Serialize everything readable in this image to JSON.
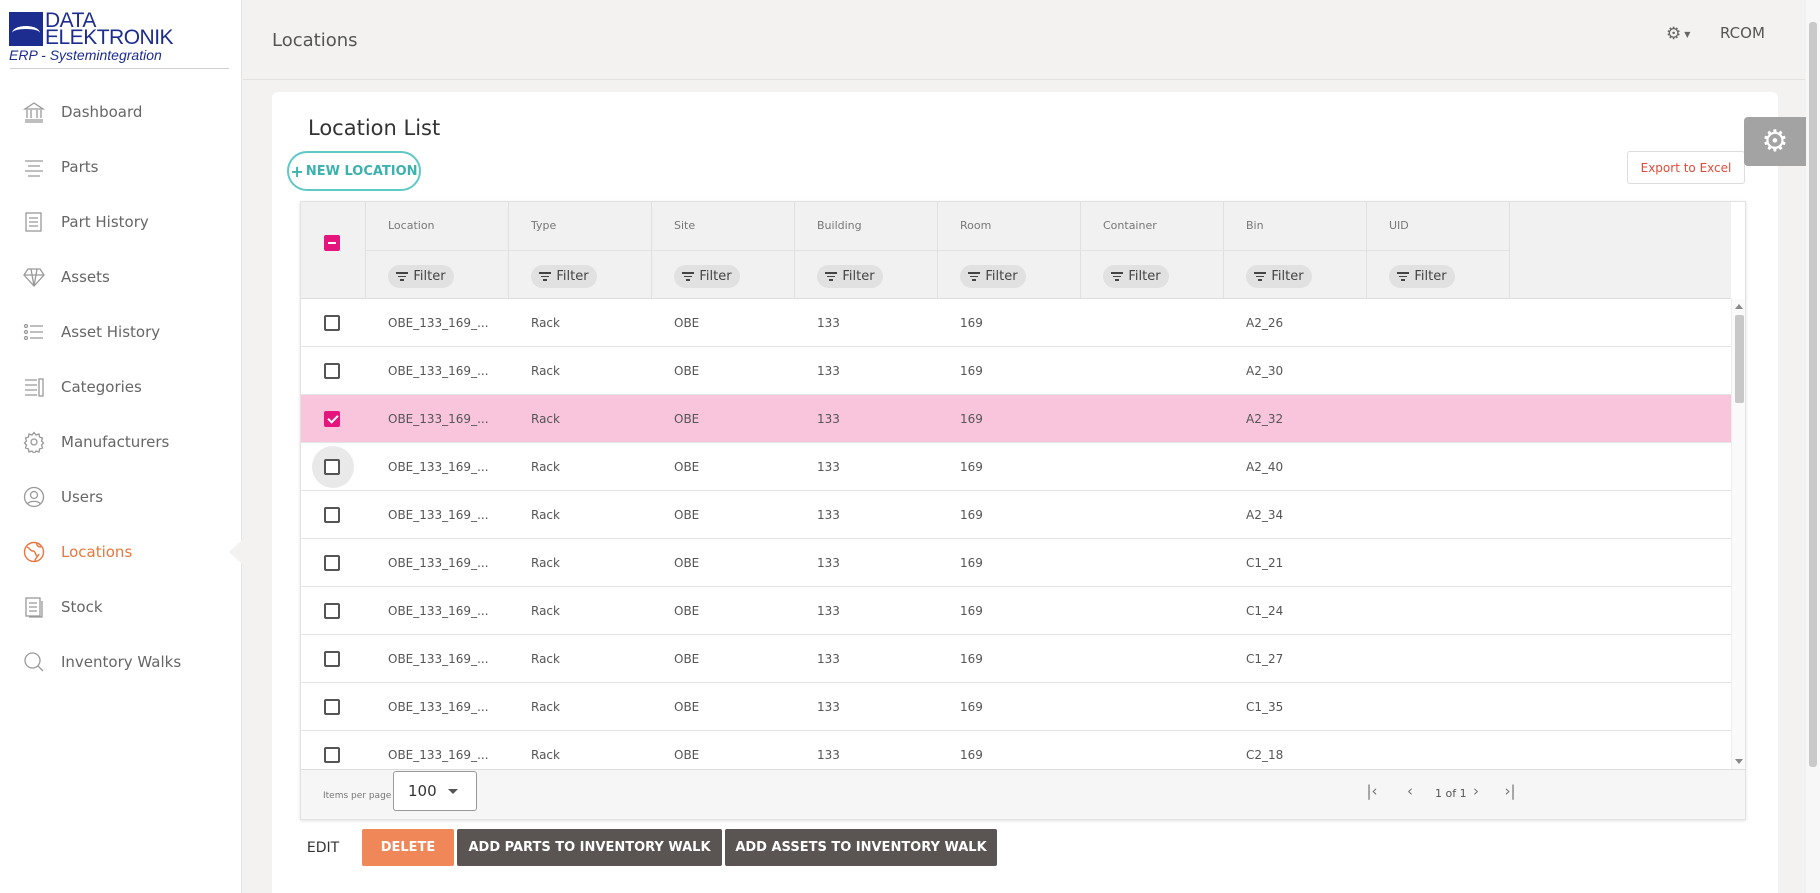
{
  "logo": {
    "line1": "DATA",
    "line2": "ELEKTRONIK",
    "sub": "ERP - Systemintegration"
  },
  "sidebar": {
    "items": [
      {
        "label": "Dashboard",
        "icon": "bank-icon"
      },
      {
        "label": "Parts",
        "icon": "lines-icon"
      },
      {
        "label": "Part History",
        "icon": "document-list-icon"
      },
      {
        "label": "Assets",
        "icon": "diamond-icon"
      },
      {
        "label": "Asset History",
        "icon": "list-icon"
      },
      {
        "label": "Categories",
        "icon": "categories-icon"
      },
      {
        "label": "Manufacturers",
        "icon": "gear-icon"
      },
      {
        "label": "Users",
        "icon": "user-icon"
      },
      {
        "label": "Locations",
        "icon": "globe-icon",
        "active": true
      },
      {
        "label": "Stock",
        "icon": "stock-icon"
      },
      {
        "label": "Inventory Walks",
        "icon": "search-icon"
      }
    ],
    "active_color": "#e8763e"
  },
  "header": {
    "title": "Locations",
    "user": "RCOM"
  },
  "card": {
    "title": "Location List",
    "new_button": "NEW LOCATION",
    "export_button": "Export to Excel"
  },
  "table": {
    "columns": [
      "Location",
      "Type",
      "Site",
      "Building",
      "Room",
      "Container",
      "Bin",
      "UID"
    ],
    "filter_label": "Filter",
    "rows": [
      {
        "location": "OBE_133_169_...",
        "type": "Rack",
        "site": "OBE",
        "building": "133",
        "room": "169",
        "container": "",
        "bin": "A2_26",
        "uid": "",
        "checked": false
      },
      {
        "location": "OBE_133_169_...",
        "type": "Rack",
        "site": "OBE",
        "building": "133",
        "room": "169",
        "container": "",
        "bin": "A2_30",
        "uid": "",
        "checked": false
      },
      {
        "location": "OBE_133_169_...",
        "type": "Rack",
        "site": "OBE",
        "building": "133",
        "room": "169",
        "container": "",
        "bin": "A2_32",
        "uid": "",
        "checked": true
      },
      {
        "location": "OBE_133_169_...",
        "type": "Rack",
        "site": "OBE",
        "building": "133",
        "room": "169",
        "container": "",
        "bin": "A2_40",
        "uid": "",
        "checked": false,
        "focused": true
      },
      {
        "location": "OBE_133_169_...",
        "type": "Rack",
        "site": "OBE",
        "building": "133",
        "room": "169",
        "container": "",
        "bin": "A2_34",
        "uid": "",
        "checked": false
      },
      {
        "location": "OBE_133_169_...",
        "type": "Rack",
        "site": "OBE",
        "building": "133",
        "room": "169",
        "container": "",
        "bin": "C1_21",
        "uid": "",
        "checked": false
      },
      {
        "location": "OBE_133_169_...",
        "type": "Rack",
        "site": "OBE",
        "building": "133",
        "room": "169",
        "container": "",
        "bin": "C1_24",
        "uid": "",
        "checked": false
      },
      {
        "location": "OBE_133_169_...",
        "type": "Rack",
        "site": "OBE",
        "building": "133",
        "room": "169",
        "container": "",
        "bin": "C1_27",
        "uid": "",
        "checked": false
      },
      {
        "location": "OBE_133_169_...",
        "type": "Rack",
        "site": "OBE",
        "building": "133",
        "room": "169",
        "container": "",
        "bin": "C1_35",
        "uid": "",
        "checked": false
      },
      {
        "location": "OBE_133_169_...",
        "type": "Rack",
        "site": "OBE",
        "building": "133",
        "room": "169",
        "container": "",
        "bin": "C2_18",
        "uid": "",
        "checked": false
      }
    ],
    "selected_row_color": "#f9c5dd",
    "items_per_page_label": "Items per page",
    "items_per_page": "100",
    "page_info": "1 of 1"
  },
  "actions": {
    "edit": "EDIT",
    "delete": "DELETE",
    "add_parts": "ADD PARTS TO INVENTORY WALK",
    "add_assets": "ADD ASSETS TO INVENTORY WALK"
  }
}
